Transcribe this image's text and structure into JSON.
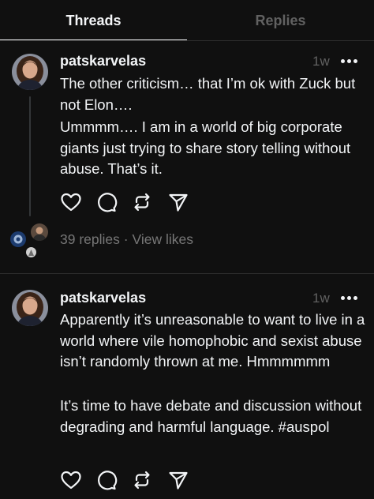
{
  "tabs": {
    "threads": "Threads",
    "replies": "Replies"
  },
  "posts": [
    {
      "username": "patskarvelas",
      "time": "1w",
      "paragraphs": [
        "The other criticism… that I’m ok with Zuck but not Elon….",
        "Ummmm…. I am in a world of big corporate giants just trying to share story telling without abuse. That’s it."
      ],
      "replies_text": "39 replies",
      "separator": "·",
      "view_likes": "View likes"
    },
    {
      "username": "patskarvelas",
      "time": "1w",
      "paragraphs": [
        "Apparently it’s unreasonable to want to live in a world where vile homophobic and sexist abuse isn’t randomly thrown at me. Hmmmmmm",
        "It’s time to have debate and discussion without degrading and harmful language. #auspol"
      ]
    }
  ],
  "icons": {
    "like": "heart-icon",
    "reply": "comment-icon",
    "repost": "repost-icon",
    "share": "send-icon",
    "more": "more-dots-icon"
  },
  "colors": {
    "background": "#101010",
    "text": "#f3f5f7",
    "muted": "#777777",
    "inactive_tab": "#616161"
  }
}
